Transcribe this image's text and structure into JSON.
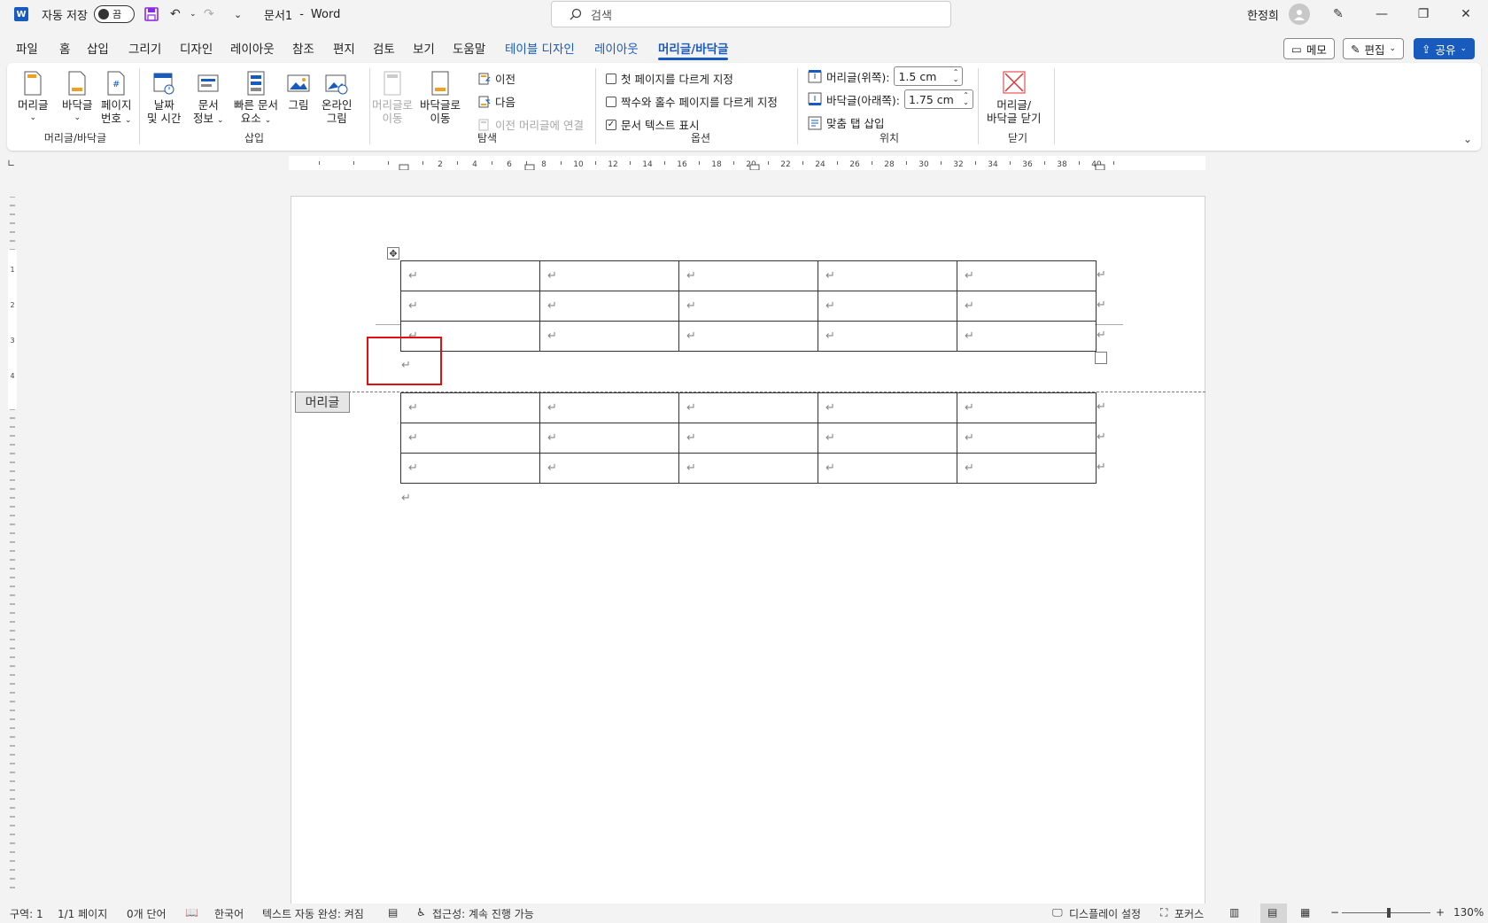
{
  "titlebar": {
    "app_icon": "W",
    "autosave_label": "자동 저장",
    "autosave_state": "끔",
    "doc_title": "문서1",
    "separator": "-",
    "app_name": "Word",
    "search_placeholder": "검색",
    "user_name": "한정희",
    "icons": [
      "save-icon",
      "undo-icon",
      "redo-icon",
      "customize-icon",
      "search-icon",
      "avatar-icon",
      "pen-icon",
      "minimize-icon",
      "restore-icon",
      "close-icon"
    ]
  },
  "tabs": [
    {
      "label": "파일"
    },
    {
      "label": "홈"
    },
    {
      "label": "삽입"
    },
    {
      "label": "그리기"
    },
    {
      "label": "디자인"
    },
    {
      "label": "레이아웃"
    },
    {
      "label": "참조"
    },
    {
      "label": "편지"
    },
    {
      "label": "검토"
    },
    {
      "label": "보기"
    },
    {
      "label": "도움말"
    },
    {
      "label": "테이블 디자인"
    },
    {
      "label": "레이아웃"
    },
    {
      "label": "머리글/바닥글"
    }
  ],
  "right_buttons": {
    "memo": "메모",
    "edit": "편집",
    "share": "공유"
  },
  "ribbon": {
    "group1": {
      "label": "머리글/바닥글",
      "header": "머리글",
      "footer": "바닥글",
      "page_number_1": "페이지",
      "page_number_2": "번호"
    },
    "group2": {
      "label": "삽입",
      "date_1": "날짜",
      "date_2": "및 시간",
      "docinfo_1": "문서",
      "docinfo_2": "정보",
      "quickparts_1": "빠른 문서",
      "quickparts_2": "요소",
      "picture": "그림",
      "online_1": "온라인",
      "online_2": "그림"
    },
    "group3": {
      "label": "탐색",
      "goto_header_1": "머리글로",
      "goto_header_2": "이동",
      "goto_footer_1": "바닥글로",
      "goto_footer_2": "이동",
      "prev": "이전",
      "next": "다음",
      "link_prev": "이전 머리글에 연결"
    },
    "group4": {
      "label": "옵션",
      "opt1": "첫 페이지를 다르게 지정",
      "opt2": "짝수와 홀수 페이지를 다르게 지정",
      "opt3": "문서 텍스트 표시",
      "opt1_checked": false,
      "opt2_checked": false,
      "opt3_checked": true
    },
    "group5": {
      "label": "위치",
      "header_top": "머리글(위쪽):",
      "header_top_value": "1.5 cm",
      "footer_bottom": "바닥글(아래쪽):",
      "footer_bottom_value": "1.75 cm",
      "align_tab": "맞춤 탭 삽입"
    },
    "group6": {
      "label": "닫기",
      "close_1": "머리글/",
      "close_2": "바닥글 닫기"
    }
  },
  "ruler": {
    "numbers": [
      "2",
      "4",
      "6",
      "8",
      "10",
      "12",
      "14",
      "16",
      "18",
      "20",
      "22",
      "24",
      "26",
      "28",
      "30",
      "32",
      "34",
      "36",
      "38",
      "40"
    ],
    "vertical_numbers": [
      "1",
      "2",
      "3",
      "4"
    ]
  },
  "document": {
    "header_tag": "머리글",
    "paragraph_mark": "↵",
    "header_table": {
      "rows": 3,
      "cols": 5
    },
    "body_table": {
      "rows": 3,
      "cols": 5
    }
  },
  "status": {
    "section": "구역: 1",
    "page": "1/1 페이지",
    "words": "0개 단어",
    "language": "한국어",
    "autocomplete": "텍스트 자동 완성: 켜짐",
    "accessibility": "접근성: 계속 진행 가능",
    "display": "디스플레이 설정",
    "focus": "포커스",
    "zoom_minus": "−",
    "zoom_plus": "+",
    "zoom": "130%"
  }
}
